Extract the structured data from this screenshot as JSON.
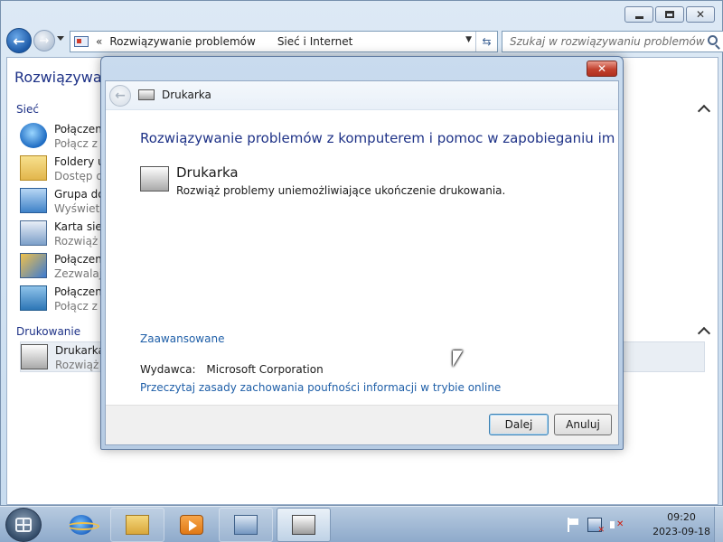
{
  "explorer": {
    "address": {
      "chevron": "«",
      "crumbs": [
        "Rozwiązywanie problemów",
        "Sieć i Internet"
      ]
    },
    "search_placeholder": "Szukaj w rozwiązywaniu problemów",
    "page_title": "Rozwiązywani",
    "sections": [
      {
        "heading": "Sieć",
        "items": [
          {
            "name": "Połączenia",
            "desc": "Połącz z In",
            "icon": "globe-icon"
          },
          {
            "name": "Foldery ud",
            "desc": "Dostęp do",
            "icon": "shared-folder-icon"
          },
          {
            "name": "Grupa dom",
            "desc": "Wyświetl",
            "icon": "homegroup-icon"
          },
          {
            "name": "Karta sieci",
            "desc": "Rozwiąż p",
            "icon": "network-adapter-icon"
          },
          {
            "name": "Połączenia",
            "desc": "Zezwalaj i",
            "icon": "incoming-connections-icon"
          },
          {
            "name": "Połączenie",
            "desc": "Połącz z s",
            "icon": "directaccess-icon"
          }
        ]
      },
      {
        "heading": "Drukowanie",
        "items": [
          {
            "name": "Drukarka",
            "desc": "Rozwiąż p",
            "icon": "printer-icon"
          }
        ]
      }
    ]
  },
  "dialog": {
    "header_title": "Drukarka",
    "title": "Rozwiązywanie problemów z komputerem i pomoc w zapobieganiu im",
    "item_name": "Drukarka",
    "item_desc": "Rozwiąż problemy uniemożliwiające ukończenie drukowania.",
    "advanced_link": "Zaawansowane",
    "publisher_label": "Wydawca:",
    "publisher_value": "Microsoft Corporation",
    "privacy_link": "Przeczytaj zasady zachowania poufności informacji w trybie online",
    "next_button": "Dalej",
    "cancel_button": "Anuluj"
  },
  "taskbar": {
    "items": [
      "internet-explorer-icon",
      "windows-explorer-icon",
      "media-player-icon",
      "control-panel-icon",
      "printer-icon"
    ],
    "clock_time": "09:20",
    "clock_date": "2023-09-18"
  }
}
